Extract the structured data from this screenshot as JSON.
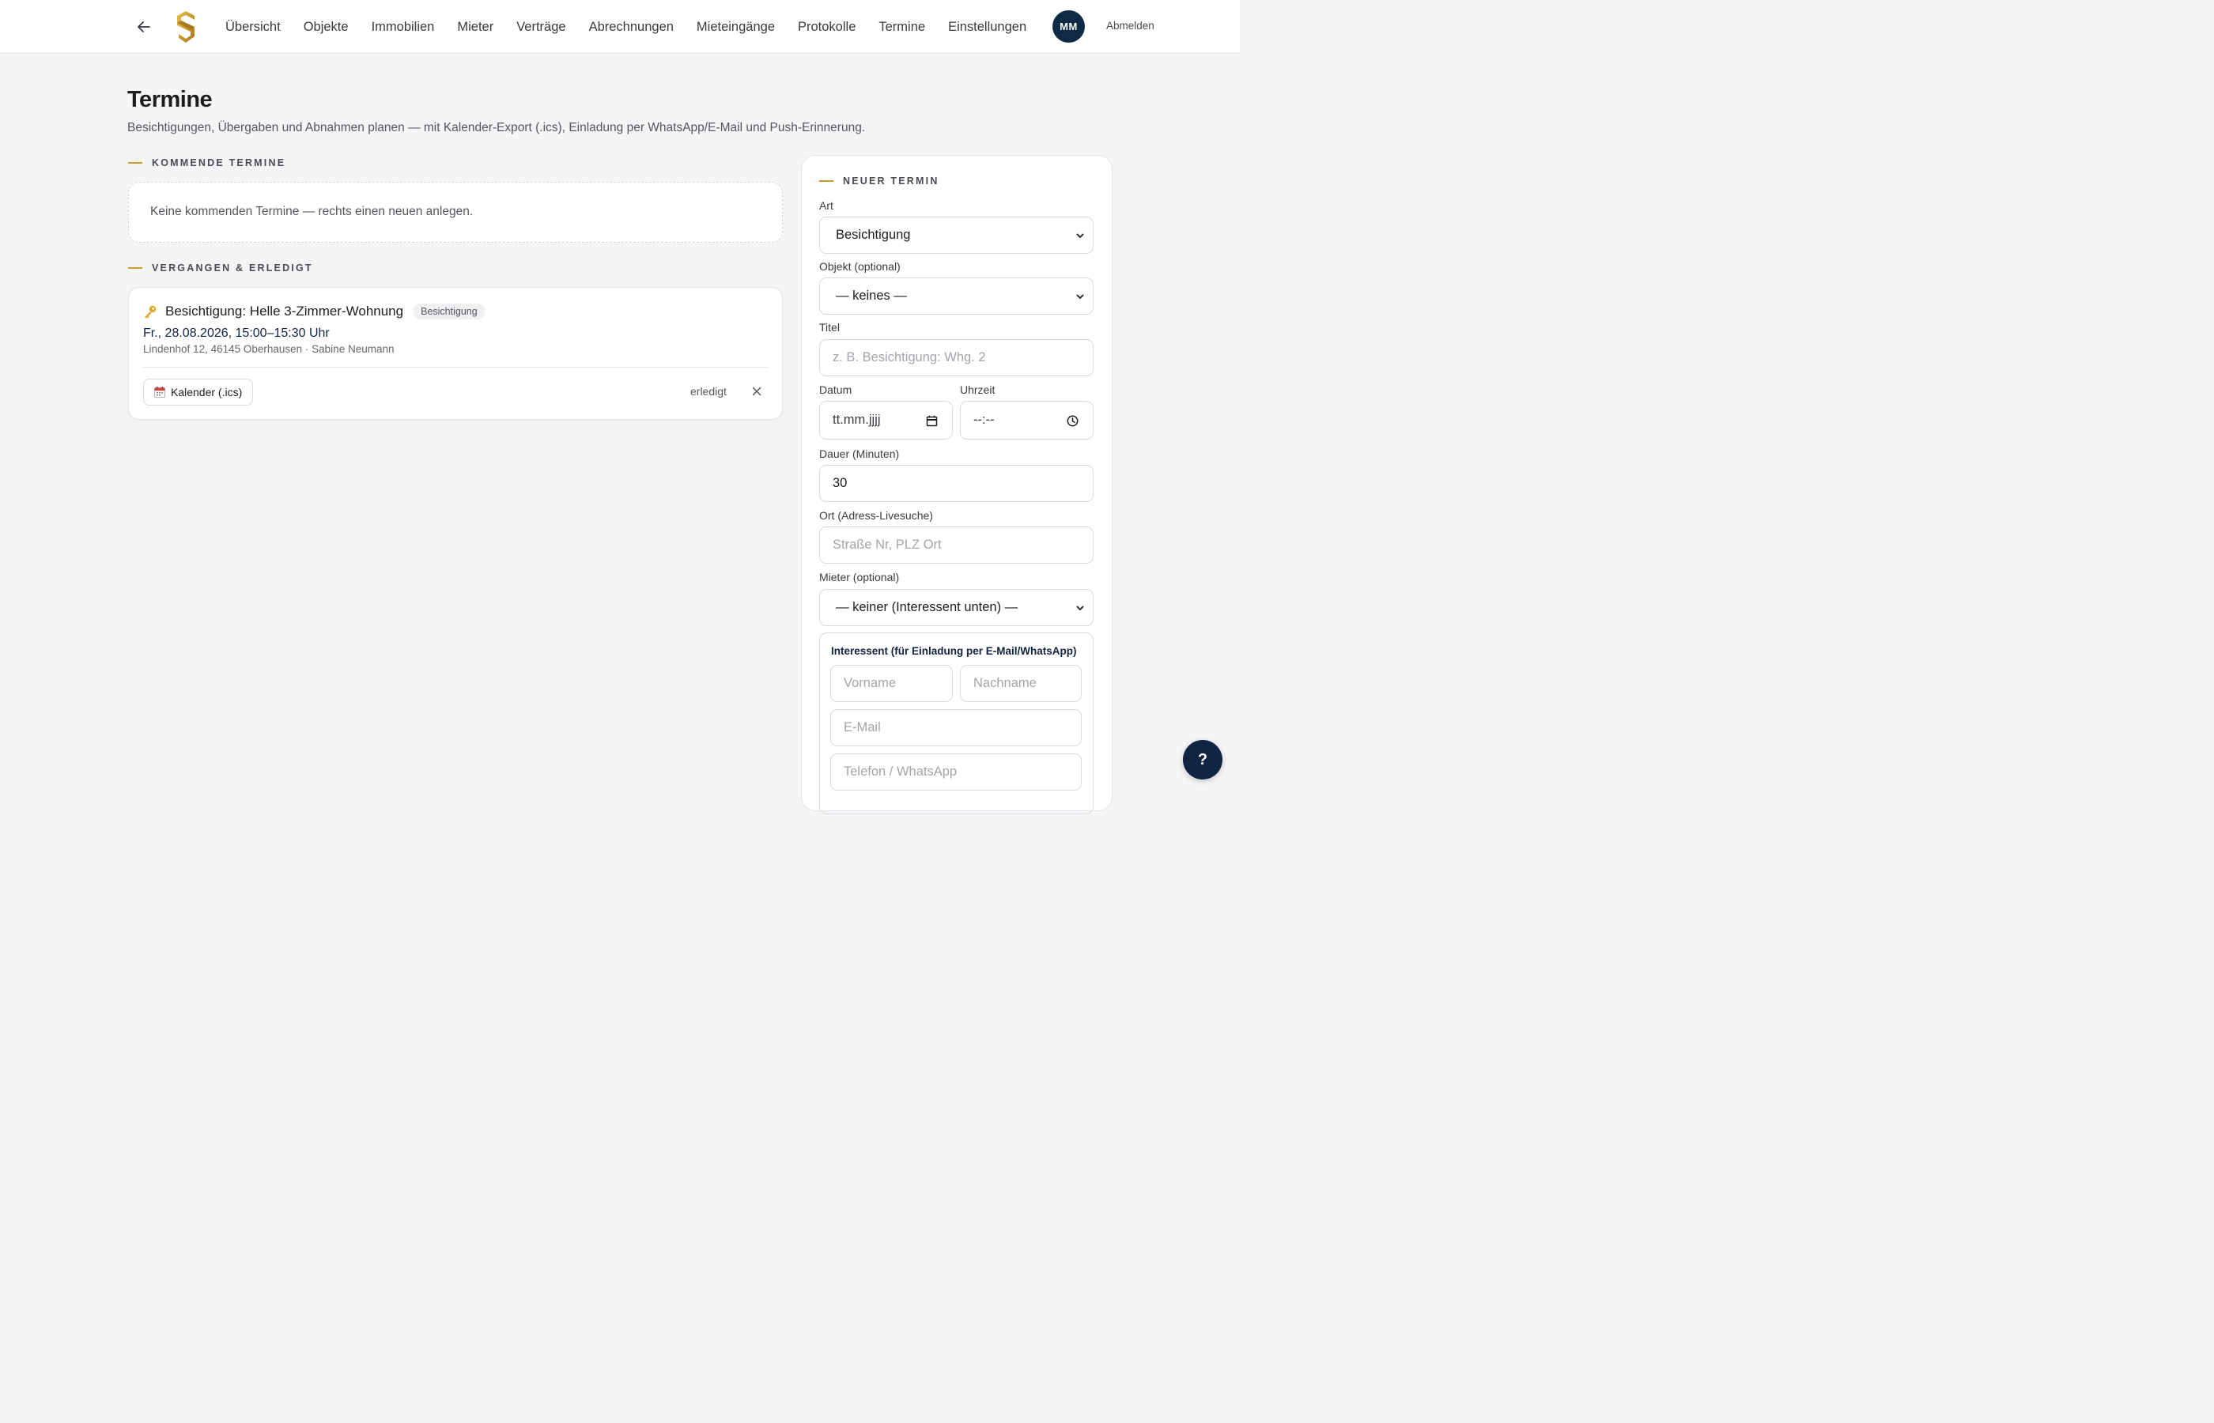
{
  "nav": {
    "items": [
      "Übersicht",
      "Objekte",
      "Immobilien",
      "Mieter",
      "Verträge",
      "Abrechnungen",
      "Mieteingänge",
      "Protokolle",
      "Termine",
      "Einstellungen"
    ],
    "avatar_initials": "MM",
    "logout_label": "Abmelden"
  },
  "page": {
    "title": "Termine",
    "subtitle": "Besichtigungen, Übergaben und Abnahmen planen — mit Kalender-Export (.ics), Einladung per WhatsApp/E-Mail und Push-Erinnerung."
  },
  "upcoming": {
    "section_label": "KOMMENDE TERMINE",
    "empty_text": "Keine kommenden Termine — rechts einen neuen anlegen."
  },
  "past": {
    "section_label": "VERGANGEN & ERLEDIGT",
    "events": [
      {
        "icon": "key-icon",
        "title": "Besichtigung: Helle 3-Zimmer-Wohnung",
        "badge": "Besichtigung",
        "datetime": "Fr., 28.08.2026, 15:00–15:30 Uhr",
        "meta": "Lindenhof 12, 46145 Oberhausen · Sabine Neumann",
        "ics_label": "Kalender (.ics)",
        "done_label": "erledigt"
      }
    ]
  },
  "form": {
    "section_label": "NEUER TERMIN",
    "art": {
      "label": "Art",
      "value": "Besichtigung"
    },
    "objekt": {
      "label": "Objekt (optional)",
      "value": "— keines —"
    },
    "titel": {
      "label": "Titel",
      "placeholder": "z. B. Besichtigung: Whg. 2"
    },
    "datum": {
      "label": "Datum",
      "placeholder": "tt.mm.jjjj"
    },
    "uhrzeit": {
      "label": "Uhrzeit",
      "placeholder": "--:--"
    },
    "dauer": {
      "label": "Dauer (Minuten)",
      "value": "30"
    },
    "ort": {
      "label": "Ort (Adress-Livesuche)",
      "placeholder": "Straße Nr, PLZ Ort"
    },
    "mieter": {
      "label": "Mieter (optional)",
      "value": "— keiner (Interessent unten) —"
    },
    "interessent": {
      "title": "Interessent (für Einladung per E-Mail/WhatsApp)",
      "vorname_placeholder": "Vorname",
      "nachname_placeholder": "Nachname",
      "email_placeholder": "E-Mail",
      "telefon_placeholder": "Telefon / WhatsApp"
    }
  },
  "help_label": "?",
  "colors": {
    "accent_gold": "#c79a2a",
    "navy": "#0f2a44"
  }
}
